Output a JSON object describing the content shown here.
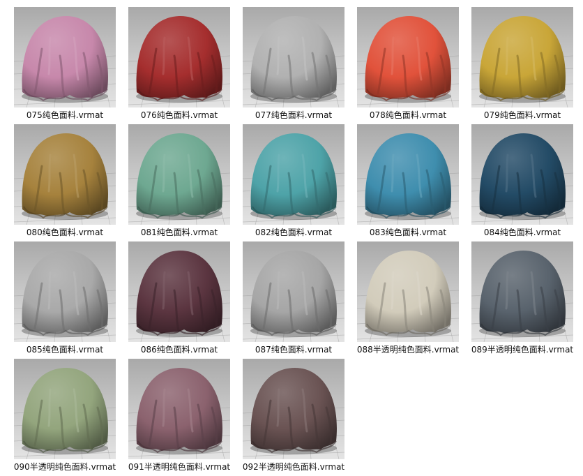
{
  "materials": [
    {
      "label": "075纯色面料.vrmat",
      "color": "#c788ab"
    },
    {
      "label": "076纯色面料.vrmat",
      "color": "#a52e2e"
    },
    {
      "label": "077纯色面料.vrmat",
      "color": "#b1b1b1"
    },
    {
      "label": "078纯色面料.vrmat",
      "color": "#e1523b"
    },
    {
      "label": "079纯色面料.vrmat",
      "color": "#c9a638"
    },
    {
      "label": "080纯色面料.vrmat",
      "color": "#a6823d"
    },
    {
      "label": "081纯色面料.vrmat",
      "color": "#6ea891"
    },
    {
      "label": "082纯色面料.vrmat",
      "color": "#4ea3a8"
    },
    {
      "label": "083纯色面料.vrmat",
      "color": "#3f8eae"
    },
    {
      "label": "084纯色面料.vrmat",
      "color": "#234b66"
    },
    {
      "label": "085纯色面料.vrmat",
      "color": "#a9a9a9"
    },
    {
      "label": "086纯色面料.vrmat",
      "color": "#5b3540"
    },
    {
      "label": "087纯色面料.vrmat",
      "color": "#a6a6a6"
    },
    {
      "label": "088半透明纯色面料.vrmat",
      "color": "#d2ccbb"
    },
    {
      "label": "089半透明纯色面料.vrmat",
      "color": "#59636d"
    },
    {
      "label": "090半透明纯色面料.vrmat",
      "color": "#93a57d"
    },
    {
      "label": "091半透明纯色面料.vrmat",
      "color": "#8b626e"
    },
    {
      "label": "092半透明纯色面料.vrmat",
      "color": "#6a5353"
    }
  ]
}
